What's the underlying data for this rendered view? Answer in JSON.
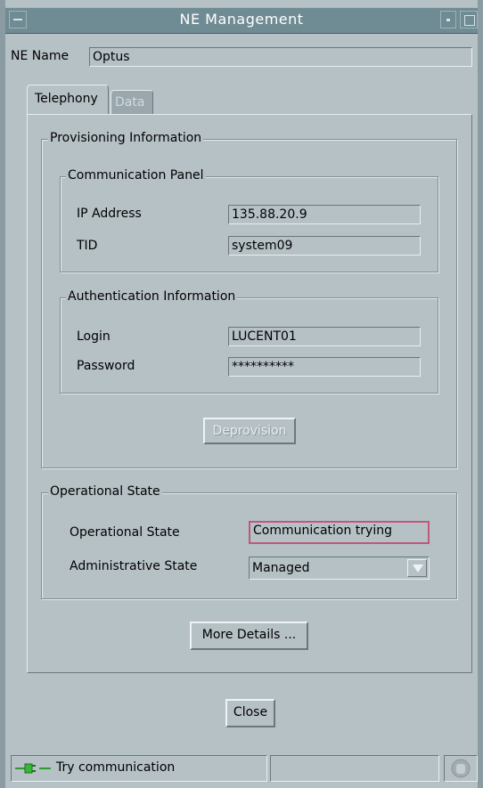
{
  "window": {
    "title": "NE Management"
  },
  "ne_name": {
    "label": "NE Name",
    "value": "Optus"
  },
  "tabs": [
    {
      "label": "Telephony",
      "active": true
    },
    {
      "label": "Data",
      "active": false
    }
  ],
  "provisioning": {
    "title": "Provisioning Information",
    "communication_panel": {
      "title": "Communication Panel",
      "ip_label": "IP Address",
      "ip_value": "135.88.20.9",
      "tid_label": "TID",
      "tid_value": "system09"
    },
    "authentication": {
      "title": "Authentication Information",
      "login_label": "Login",
      "login_value": "LUCENT01",
      "password_label": "Password",
      "password_value": "**********"
    },
    "deprovision_label": "Deprovision"
  },
  "operational": {
    "title": "Operational State",
    "op_state_label": "Operational State",
    "op_state_value": "Communication trying",
    "admin_state_label": "Administrative State",
    "admin_state_value": "Managed"
  },
  "more_details_label": "More Details ...",
  "close_label": "Close",
  "status": {
    "message": "Try communication",
    "connector_icon": "plug-icon",
    "busy_icon": "hand-icon"
  },
  "colors": {
    "background": "#b6c1c6",
    "titlebar": "#6f8b93",
    "error_border": "#c0587a"
  }
}
